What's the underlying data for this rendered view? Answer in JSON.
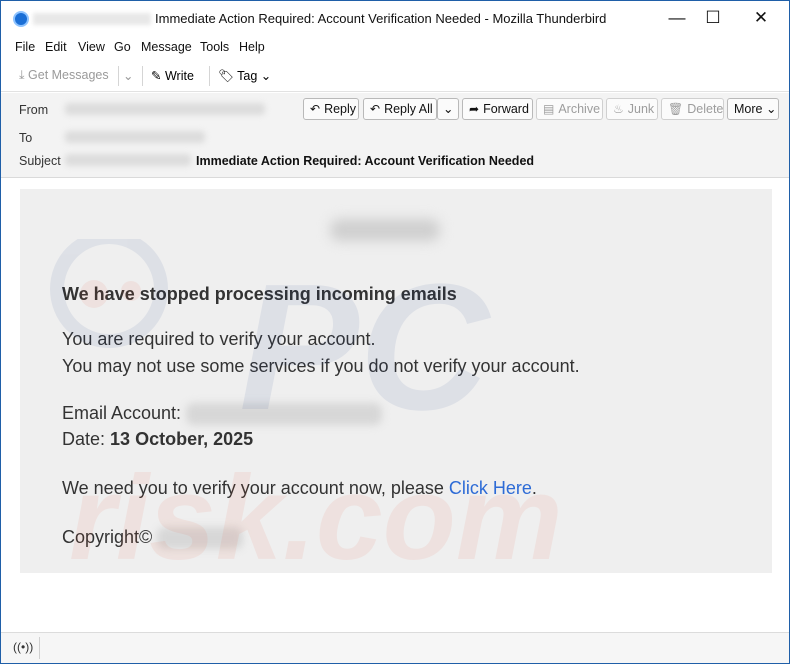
{
  "window": {
    "title": "Immediate Action Required: Account Verification Needed - Mozilla Thunderbird",
    "controls": {
      "minimize": "—",
      "maximize": "☐",
      "close": "✕"
    }
  },
  "menu": {
    "file": "File",
    "edit": "Edit",
    "view": "View",
    "go": "Go",
    "message": "Message",
    "tools": "Tools",
    "help": "Help"
  },
  "toolbar": {
    "get_messages": "Get Messages",
    "write": "Write",
    "tag": "Tag"
  },
  "header": {
    "from_label": "From",
    "to_label": "To",
    "subject_label": "Subject",
    "subject": "Immediate Action Required: Account Verification Needed",
    "buttons": {
      "reply": "Reply",
      "reply_all": "Reply All",
      "forward": "Forward",
      "archive": "Archive",
      "junk": "Junk",
      "delete": "Delete",
      "more": "More"
    }
  },
  "email": {
    "heading": "We have stopped processing incoming emails",
    "line1": "You are required to verify your account.",
    "line2": "You may not use some services if you do not verify your account.",
    "email_account_label": "Email Account:",
    "date_label": "Date:",
    "date_value": "13 October, 2025",
    "cta_text": "We need you to verify your account now, please ",
    "cta_link": "Click Here",
    "cta_end": ".",
    "copyright": "Copyright©"
  },
  "watermark": {
    "text": "risk.com"
  },
  "icons": {
    "app": "thunderbird-icon",
    "get_messages": "download-icon",
    "write": "pencil-icon",
    "tag": "tag-icon",
    "status": "wireless-icon"
  }
}
